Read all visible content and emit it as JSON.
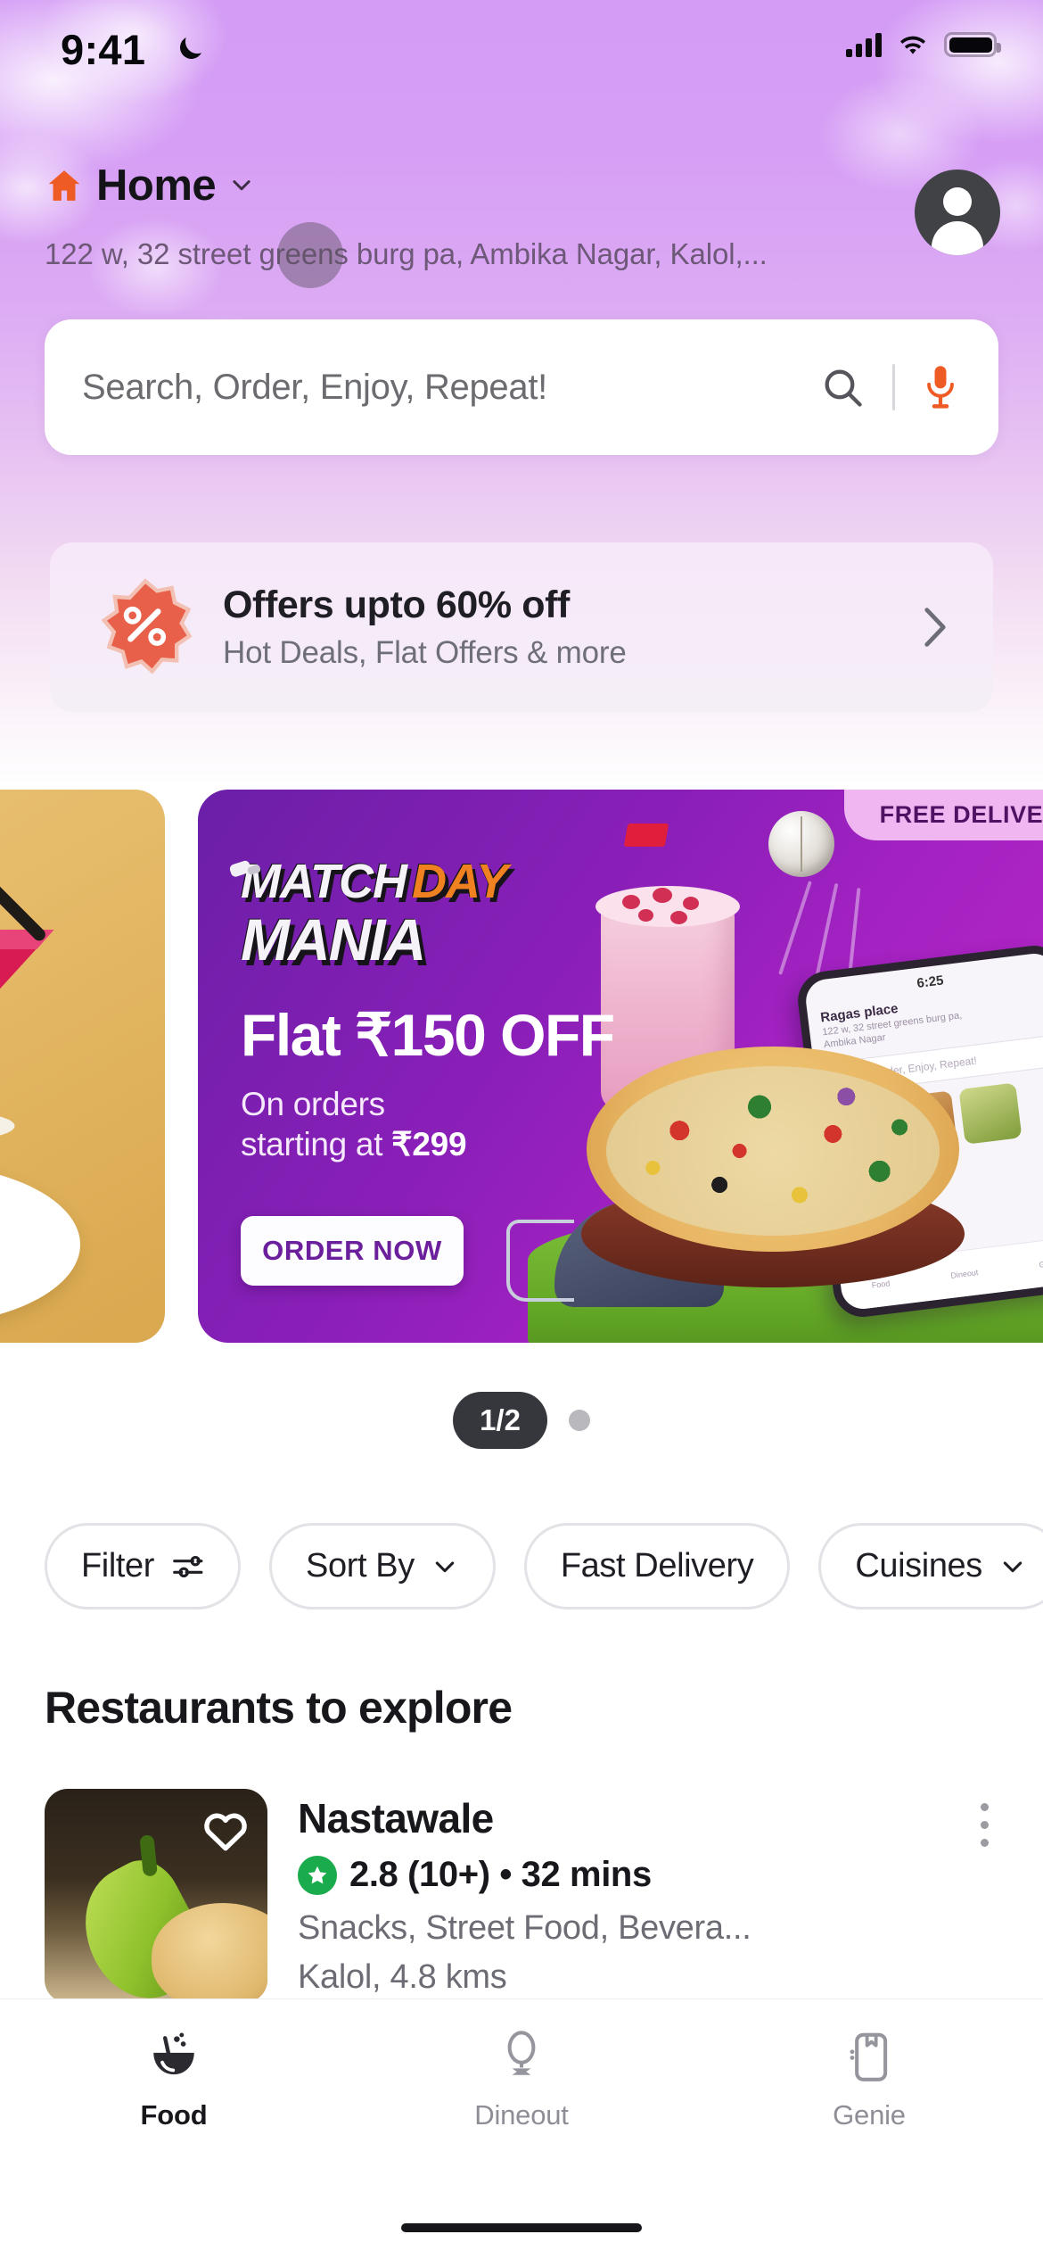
{
  "status_bar": {
    "time": "9:41",
    "moon_icon": "crescent-moon-icon",
    "signal_icon": "cellular-signal-icon",
    "wifi_icon": "wifi-icon",
    "battery_icon": "battery-full-icon"
  },
  "header": {
    "location_label": "Home",
    "location_icon": "home-icon",
    "chevron_icon": "chevron-down-icon",
    "address": "122 w, 32 street greens burg pa, Ambika Nagar, Kalol,...",
    "avatar_icon": "user-avatar-icon"
  },
  "search": {
    "placeholder": "Search, Order, Enjoy, Repeat!",
    "value": "",
    "search_icon": "search-icon",
    "mic_icon": "microphone-icon"
  },
  "offers_strip": {
    "icon": "percent-badge-icon",
    "title": "Offers upto 60% off",
    "subtitle": "Hot Deals, Flat Offers & more",
    "arrow_icon": "chevron-right-icon"
  },
  "carousel": {
    "page_indicator": "1/2",
    "dot_count": 1,
    "banners": [
      {
        "id": "cocktail-banner",
        "bg_color": "#e2b560"
      },
      {
        "id": "match-day-mania-banner",
        "badge": "FREE DELIVERY",
        "logo_line1_a": "MATCH",
        "logo_line1_b": "DAY",
        "logo_line2": "MANIA",
        "headline": "Flat ₹150 OFF",
        "sub_line1": "On orders",
        "sub_line2_prefix": "starting at ",
        "sub_line2_amount": "₹299",
        "cta": "ORDER NOW",
        "bg_color": "#8a1fb8",
        "badge_bg": "#f0b6f2",
        "badge_text_color": "#4f1163"
      }
    ]
  },
  "filters": [
    {
      "label": "Filter",
      "icon": "sliders-icon",
      "has_chevron": false
    },
    {
      "label": "Sort By",
      "icon": "",
      "has_chevron": true
    },
    {
      "label": "Fast Delivery",
      "icon": "",
      "has_chevron": false
    },
    {
      "label": "Cuisines",
      "icon": "",
      "has_chevron": true
    }
  ],
  "section": {
    "title": "Restaurants to explore"
  },
  "restaurants": [
    {
      "name": "Nastawale",
      "rating": "2.8 (10+) • 32 mins",
      "rating_color": "#1aab4c",
      "star_icon": "star-icon",
      "cuisine": "Snacks, Street Food, Bevera...",
      "cuisine_more": "Kalol, 4.8 kms",
      "favorite_icon": "heart-outline-icon",
      "menu_icon": "kebab-menu-icon"
    }
  ],
  "bottom_nav": [
    {
      "label": "Food",
      "icon": "food-bowl-icon",
      "active": true
    },
    {
      "label": "Dineout",
      "icon": "wine-glass-icon",
      "active": false
    },
    {
      "label": "Genie",
      "icon": "genie-bag-icon",
      "active": false
    }
  ],
  "colors": {
    "brand_orange": "#ef5b25",
    "hero_purple": "#d49cf5",
    "banner_purple": "#8a1fb8",
    "rating_green": "#1aab4c"
  }
}
